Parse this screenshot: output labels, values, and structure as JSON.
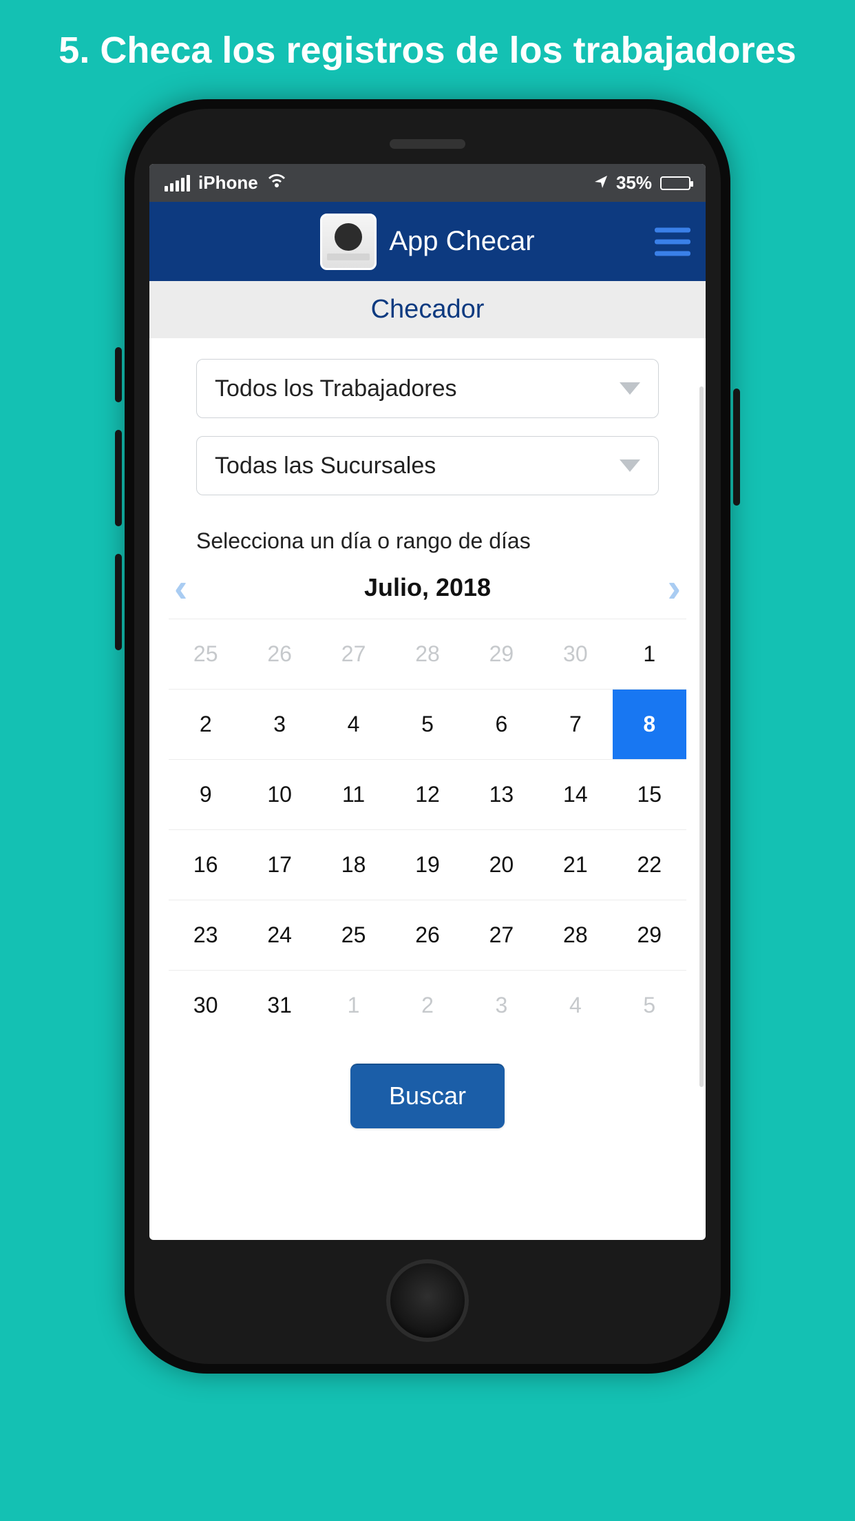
{
  "promo": {
    "heading": "5. Checa los registros de los trabajadores"
  },
  "status": {
    "carrier": "iPhone",
    "battery_label": "35%"
  },
  "header": {
    "title": "App Checar"
  },
  "page": {
    "subtitle": "Checador"
  },
  "filters": {
    "workers_label": "Todos los Trabajadores",
    "branches_label": "Todas las Sucursales"
  },
  "help": {
    "text": "Selecciona un día o rango de días"
  },
  "calendar": {
    "month_label": "Julio, 2018",
    "selected_day": "8",
    "days": [
      {
        "d": "25",
        "o": true
      },
      {
        "d": "26",
        "o": true
      },
      {
        "d": "27",
        "o": true
      },
      {
        "d": "28",
        "o": true
      },
      {
        "d": "29",
        "o": true
      },
      {
        "d": "30",
        "o": true
      },
      {
        "d": "1"
      },
      {
        "d": "2"
      },
      {
        "d": "3"
      },
      {
        "d": "4"
      },
      {
        "d": "5"
      },
      {
        "d": "6"
      },
      {
        "d": "7"
      },
      {
        "d": "8",
        "sel": true
      },
      {
        "d": "9"
      },
      {
        "d": "10"
      },
      {
        "d": "11"
      },
      {
        "d": "12"
      },
      {
        "d": "13"
      },
      {
        "d": "14"
      },
      {
        "d": "15"
      },
      {
        "d": "16"
      },
      {
        "d": "17"
      },
      {
        "d": "18"
      },
      {
        "d": "19"
      },
      {
        "d": "20"
      },
      {
        "d": "21"
      },
      {
        "d": "22"
      },
      {
        "d": "23"
      },
      {
        "d": "24"
      },
      {
        "d": "25"
      },
      {
        "d": "26"
      },
      {
        "d": "27"
      },
      {
        "d": "28"
      },
      {
        "d": "29"
      },
      {
        "d": "30"
      },
      {
        "d": "31"
      },
      {
        "d": "1",
        "o": true
      },
      {
        "d": "2",
        "o": true
      },
      {
        "d": "3",
        "o": true
      },
      {
        "d": "4",
        "o": true
      },
      {
        "d": "5",
        "o": true
      }
    ]
  },
  "actions": {
    "search_label": "Buscar"
  }
}
